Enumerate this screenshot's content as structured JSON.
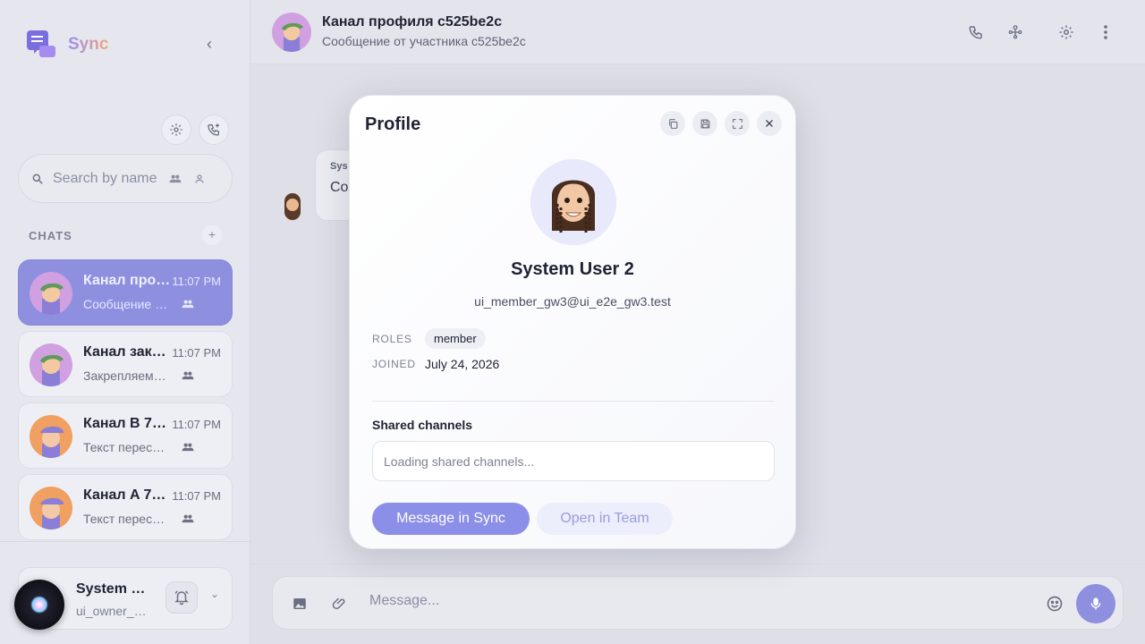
{
  "app": {
    "name": "Sync",
    "accent": "#8f8fe0"
  },
  "sidebar": {
    "search_placeholder": "Search by name",
    "chats_label": "CHATS",
    "add_label": "+",
    "chats": [
      {
        "title": "Канал про…",
        "time": "11:07 PM",
        "preview": "Сообщение о…",
        "active": true
      },
      {
        "title": "Канал зак…",
        "time": "11:07 PM",
        "preview": "Закрепляемо…",
        "active": false
      },
      {
        "title": "Канал B 7d…",
        "time": "11:07 PM",
        "preview": "Текст пересы…",
        "active": false
      },
      {
        "title": "Канал A 7d…",
        "time": "11:07 PM",
        "preview": "Текст пересы…",
        "active": false
      }
    ],
    "user": {
      "name": "System U…",
      "email": "ui_owner_g…"
    }
  },
  "chat": {
    "title": "Канал профиля c525be2c",
    "subtitle": "Сообщение от участника c525be2c",
    "message": {
      "sender": "Sys",
      "text": "Co"
    },
    "composer_placeholder": "Message..."
  },
  "profile_modal": {
    "title": "Profile",
    "name": "System User 2",
    "email": "ui_member_gw3@ui_e2e_gw3.test",
    "roles_label": "ROLES",
    "role": "member",
    "joined_label": "JOINED",
    "joined": "July 24, 2026",
    "shared_channels_title": "Shared channels",
    "shared_channels_loading": "Loading shared channels...",
    "primary_button": "Message in Sync",
    "secondary_button": "Open in Team"
  }
}
